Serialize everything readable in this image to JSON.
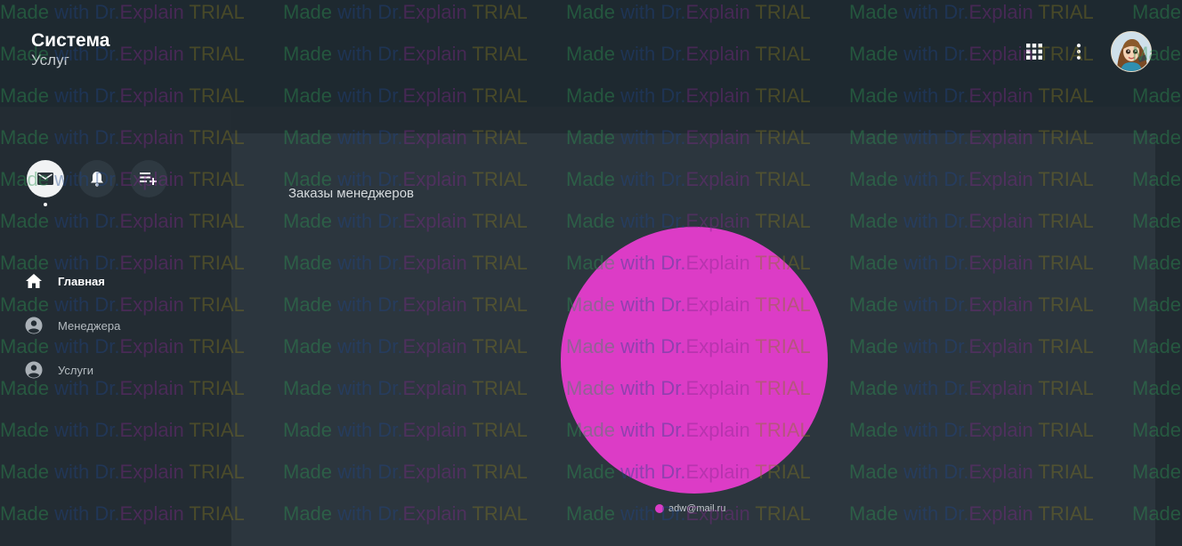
{
  "header": {
    "title": "Система",
    "subtitle": "Услуг",
    "apps_icon": "apps-grid-icon",
    "more_icon": "more-vert-icon",
    "avatar_icon": "user-avatar"
  },
  "sidebar": {
    "quick_actions": [
      {
        "icon": "mail-icon",
        "active": true
      },
      {
        "icon": "bell-icon",
        "active": false
      },
      {
        "icon": "playlist-add-icon",
        "active": false
      }
    ],
    "items": [
      {
        "label": "Главная",
        "icon": "home-icon",
        "active": true
      },
      {
        "label": "Менеджера",
        "icon": "account-circle-icon",
        "active": false
      },
      {
        "label": "Услуги",
        "icon": "account-circle-icon",
        "active": false
      }
    ]
  },
  "main": {
    "card_title": "Заказы менеджеров"
  },
  "chart_data": {
    "type": "pie",
    "title": "Заказы менеджеров",
    "categories": [
      "adw@mail.ru"
    ],
    "values": [
      1
    ],
    "colors": [
      "#dc3cc6"
    ],
    "legend_position": "bottom"
  },
  "watermark": {
    "made": "Made",
    "with": "with",
    "dr": "Dr.",
    "explain": "Explain",
    "trial": "TRIAL"
  },
  "colors": {
    "background": "#222b32",
    "header": "#1e2930",
    "card": "#2c363e",
    "slice": "#dc3cc6"
  }
}
